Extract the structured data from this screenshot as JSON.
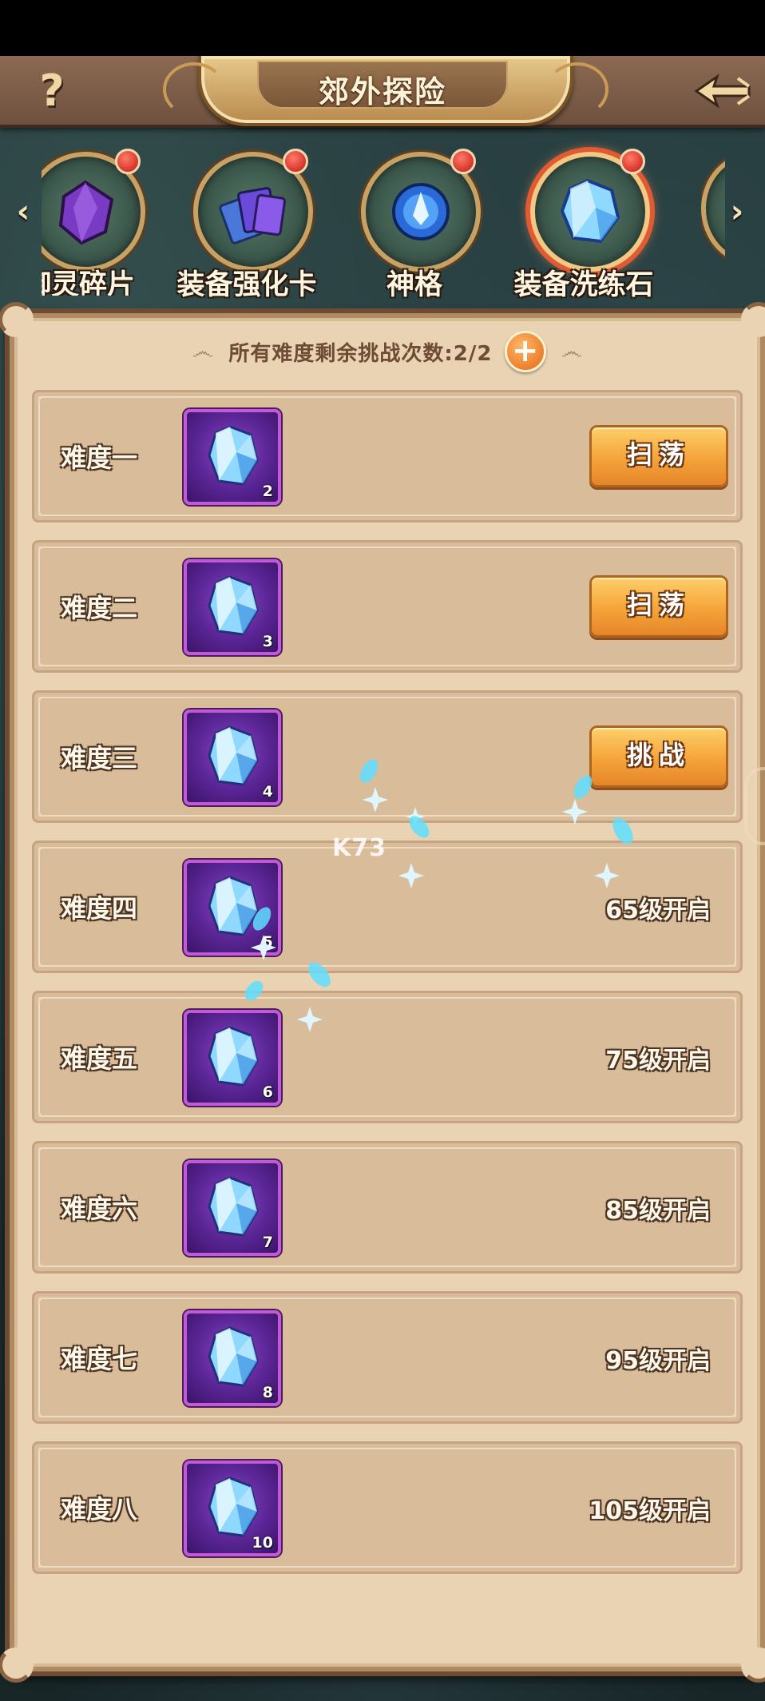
{
  "header": {
    "title": "郊外探险",
    "help_glyph": "?"
  },
  "categories": [
    {
      "label": "御灵碎片",
      "icon": "purple-crystal-shard-icon",
      "has_alert": true
    },
    {
      "label": "装备强化卡",
      "icon": "upgrade-cards-icon",
      "has_alert": true
    },
    {
      "label": "神格",
      "icon": "blue-orb-icon",
      "has_alert": true
    },
    {
      "label": "装备洗练石",
      "icon": "refine-stone-icon",
      "has_alert": true,
      "selected": true
    }
  ],
  "attempts": {
    "text": "所有难度剩余挑战次数:2/2",
    "add_glyph": "+"
  },
  "difficulties": [
    {
      "label": "难度一",
      "reward_count": "2",
      "action": "扫荡",
      "unlock": ""
    },
    {
      "label": "难度二",
      "reward_count": "3",
      "action": "扫荡",
      "unlock": ""
    },
    {
      "label": "难度三",
      "reward_count": "4",
      "action": "挑战",
      "unlock": ""
    },
    {
      "label": "难度四",
      "reward_count": "5",
      "action": "",
      "unlock": "65级开启"
    },
    {
      "label": "难度五",
      "reward_count": "6",
      "action": "",
      "unlock": "75级开启"
    },
    {
      "label": "难度六",
      "reward_count": "7",
      "action": "",
      "unlock": "85级开启"
    },
    {
      "label": "难度七",
      "reward_count": "8",
      "action": "",
      "unlock": "95级开启"
    },
    {
      "label": "难度八",
      "reward_count": "10",
      "action": "",
      "unlock": "105级开启"
    }
  ],
  "watermark": "K73",
  "colors": {
    "panel": "#e9d3b3",
    "row": "#d9bc9a",
    "button": "#f4a43a",
    "alert": "#c4160c",
    "slot": "#5a2595"
  }
}
